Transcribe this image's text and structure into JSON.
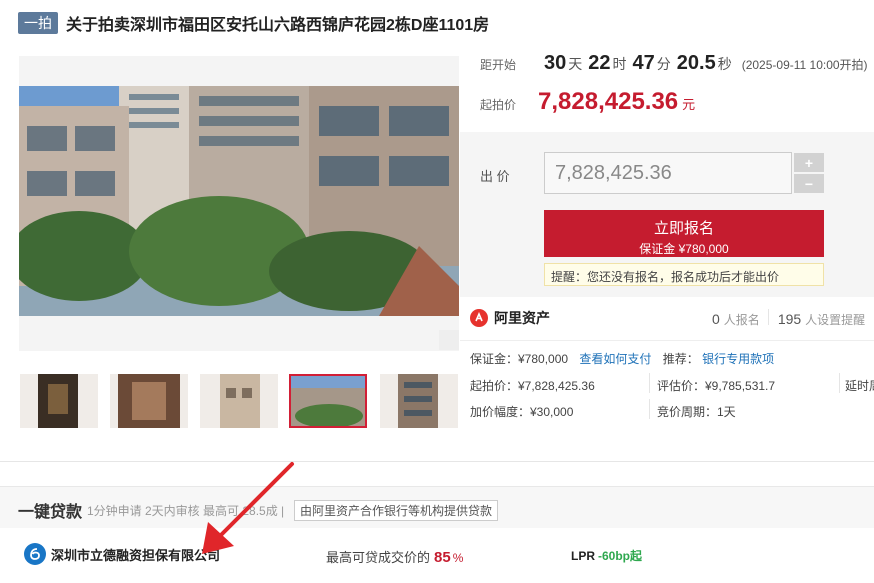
{
  "header": {
    "badge": "一拍",
    "title": "关于拍卖深圳市福田区安托山六路西锦庐花园2栋D座1101房"
  },
  "auction": {
    "countdown_label": "距开始",
    "days": "30",
    "days_unit": "天",
    "hours": "22",
    "hours_unit": "时",
    "minutes": "47",
    "minutes_unit": "分",
    "seconds": "20.5",
    "seconds_unit": "秒",
    "start_time": "(2025-09-11 10:00开拍)",
    "start_price_label": "起拍价",
    "start_price": "7,828,425.36",
    "start_price_unit": "元",
    "bid_label": "出 价",
    "bid_value": "7,828,425.36",
    "plus": "+",
    "minus": "−",
    "apply_label": "立即报名",
    "apply_deposit": "保证金 ¥780,000",
    "notice": "提醒：您还没有报名，报名成功后才能出价"
  },
  "gallery": {
    "zoom_icon": "magnifier-icon",
    "thumb_count": 5,
    "active_thumb": 3
  },
  "info": {
    "brand": "阿里资产",
    "brand_icon": "ali-icon",
    "signups": "0",
    "signups_label": "人报名",
    "reminders": "195",
    "reminders_label": "人设置提醒",
    "deposit": "保证金：¥780,000",
    "deposit_link": "查看如何支付",
    "recommend": "推荐：",
    "recommend_link": "银行专用款项",
    "start_price": "起拍价：¥7,828,425.36",
    "appraisal": "评估价：¥9,785,531.7",
    "delay": "延时周",
    "increment": "加价幅度：¥30,000",
    "cycle": "竞价周期：1天"
  },
  "loan": {
    "title": "一键贷款",
    "desc": "1分钟申请 2天内审核 最高可 28.5成 |",
    "tag": "由阿里资产合作银行等机构提供贷款",
    "company": "深圳市立德融资担保有限公司",
    "ratio_label": "最高可贷成交价的",
    "ratio_value": "85",
    "ratio_unit": "%",
    "lpr_label": "LPR",
    "lpr_value": "-60bp起"
  },
  "colors": {
    "accent_red": "#c51c2f",
    "link_blue": "#1f72b8",
    "badge_blue": "#5d7a9b",
    "annotation_arrow": "#e0262a"
  }
}
